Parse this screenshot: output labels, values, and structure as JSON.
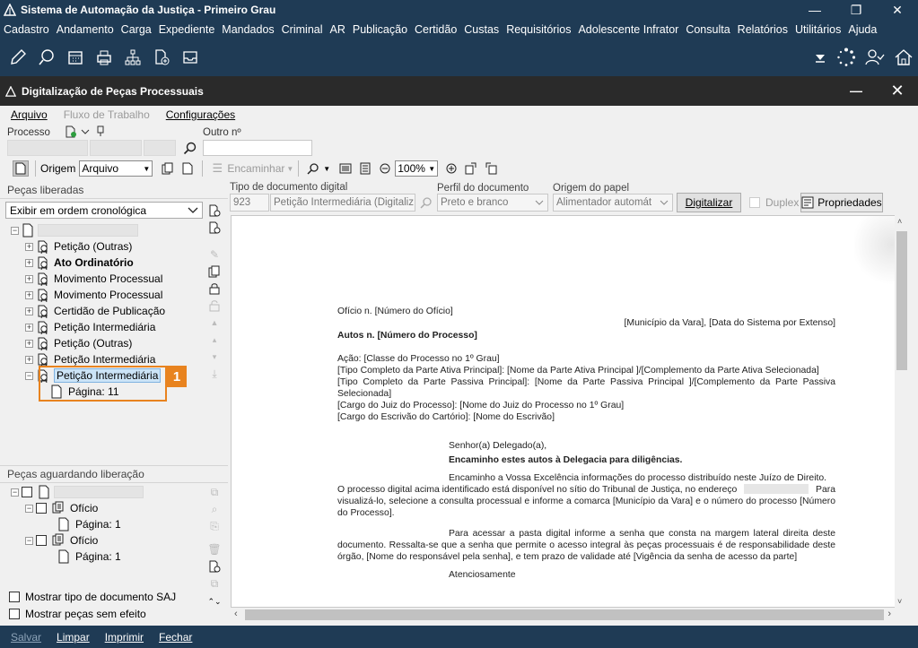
{
  "app": {
    "title": "Sistema de Automação da Justiça - Primeiro Grau"
  },
  "menu": [
    "Cadastro",
    "Andamento",
    "Carga",
    "Expediente",
    "Mandados",
    "Criminal",
    "AR",
    "Publicação",
    "Certidão",
    "Custas",
    "Requisitórios",
    "Adolescente Infrator",
    "Consulta",
    "Relatórios",
    "Utilitários",
    "Ajuda"
  ],
  "subwindow": {
    "title": "Digitalização de Peças Processuais"
  },
  "menu2": {
    "arquivo": "Arquivo",
    "fluxo": "Fluxo de Trabalho",
    "config": "Configurações"
  },
  "fields": {
    "processo_label": "Processo",
    "outro_label": "Outro nº"
  },
  "toolbar": {
    "origem_label": "Origem",
    "origem_value": "Arquivo",
    "encaminhar": "Encaminhar",
    "zoom": "100%"
  },
  "left": {
    "header": "Peças liberadas",
    "sort_option": "Exibir em ordem cronológica",
    "tree": [
      {
        "label": "Petição (Outras)",
        "bold": false
      },
      {
        "label": "Ato Ordinatório",
        "bold": true
      },
      {
        "label": "Movimento Processual",
        "bold": false
      },
      {
        "label": "Movimento Processual",
        "bold": false
      },
      {
        "label": "Certidão de Publicação",
        "bold": false
      },
      {
        "label": "Petição Intermediária",
        "bold": false
      },
      {
        "label": "Petição (Outras)",
        "bold": false
      },
      {
        "label": "Petição Intermediária",
        "bold": false
      },
      {
        "label": "Petição Intermediária",
        "bold": false,
        "selected": true
      }
    ],
    "page_label": "Página: 11",
    "callout": "1",
    "waiting_header": "Peças aguardando liberação",
    "waiting": [
      {
        "label": "Ofício",
        "page": "Página: 1"
      },
      {
        "label": "Ofício",
        "page": "Página: 1"
      }
    ],
    "check1": "Mostrar tipo de documento SAJ",
    "check2": "Mostrar peças sem efeito"
  },
  "digital": {
    "tipo_label": "Tipo de documento digital",
    "tipo_code": "923",
    "tipo_value": "Petição Intermediária (Digitaliz",
    "perfil_label": "Perfil do documento",
    "perfil_value": "Preto e branco",
    "origem_label": "Origem do papel",
    "origem_value": "Alimentador automát",
    "digitalizar": "Digitalizar",
    "duplex": "Duplex",
    "propriedades": "Propriedades"
  },
  "document": {
    "l1": "Ofício n. [Número do Ofício]",
    "l2": "[Município da Vara], [Data do Sistema por Extenso]",
    "l3": "Autos n. [Número do Processo]",
    "l4": "Ação: [Classe do Processo no 1º Grau]",
    "l5": "[Tipo Completo da Parte Ativa Principal]: [Nome da Parte Ativa Principal ]/[Complemento da Parte Ativa Selecionada]",
    "l6": "[Tipo Completo da Parte Passiva Principal]: [Nome da Parte Passiva Principal ]/[Complemento da Parte Passiva Selecionada]",
    "l7": "[Cargo do Juiz do Processo]: [Nome do Juiz do Processo no 1º Grau]",
    "l8": "[Cargo do Escrivão do Cartório]: [Nome do Escrivão]",
    "l9": "Senhor(a) Delegado(a),",
    "l10": "Encaminho estes autos à Delegacia para diligências.",
    "l11a": "Encaminho a Vossa Excelência informações do processo distribuído neste Juízo de Direito.",
    "l11b": "O processo digital acima identificado está disponível no sítio do Tribunal de Justiça, no endereço",
    "l11c": "Para",
    "l11d": "visualizá-lo, selecione a consulta processual e informe a comarca  [Município da Vara] e o número do processo [Número do Processo].",
    "l12": "Para acessar a pasta digital informe a senha que consta na margem lateral direita deste documento. Ressalta-se que a senha que permite o acesso integral às peças processuais é de responsabilidade deste órgão, [Nome do responsável pela senha], e tem prazo de validade até [Vigência da senha de acesso da parte]",
    "l13": "Atenciosamente"
  },
  "footer": {
    "salvar": "Salvar",
    "limpar": "Limpar",
    "imprimir": "Imprimir",
    "fechar": "Fechar"
  }
}
